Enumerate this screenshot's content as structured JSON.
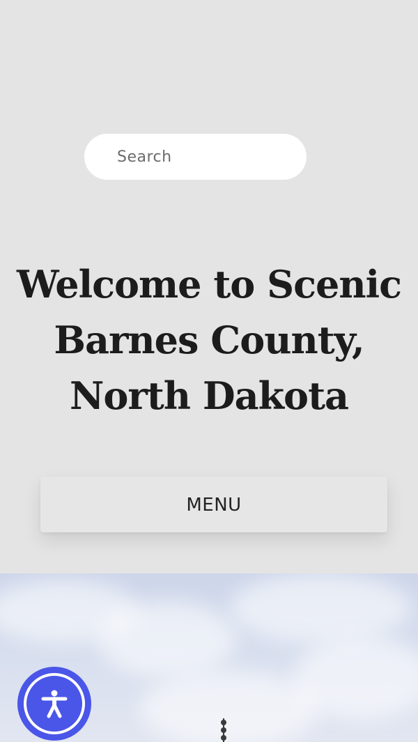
{
  "search": {
    "placeholder": "Search"
  },
  "hero": {
    "title": "Welcome to Scenic Barnes County, North Dakota"
  },
  "nav": {
    "menu_label": "MENU"
  },
  "accessibility": {
    "icon": "accessibility-person-icon",
    "color": "#4a56e8"
  },
  "colors": {
    "background": "#e4e4e4",
    "title": "#1c1c1c",
    "sky": "#cdd6ea"
  }
}
